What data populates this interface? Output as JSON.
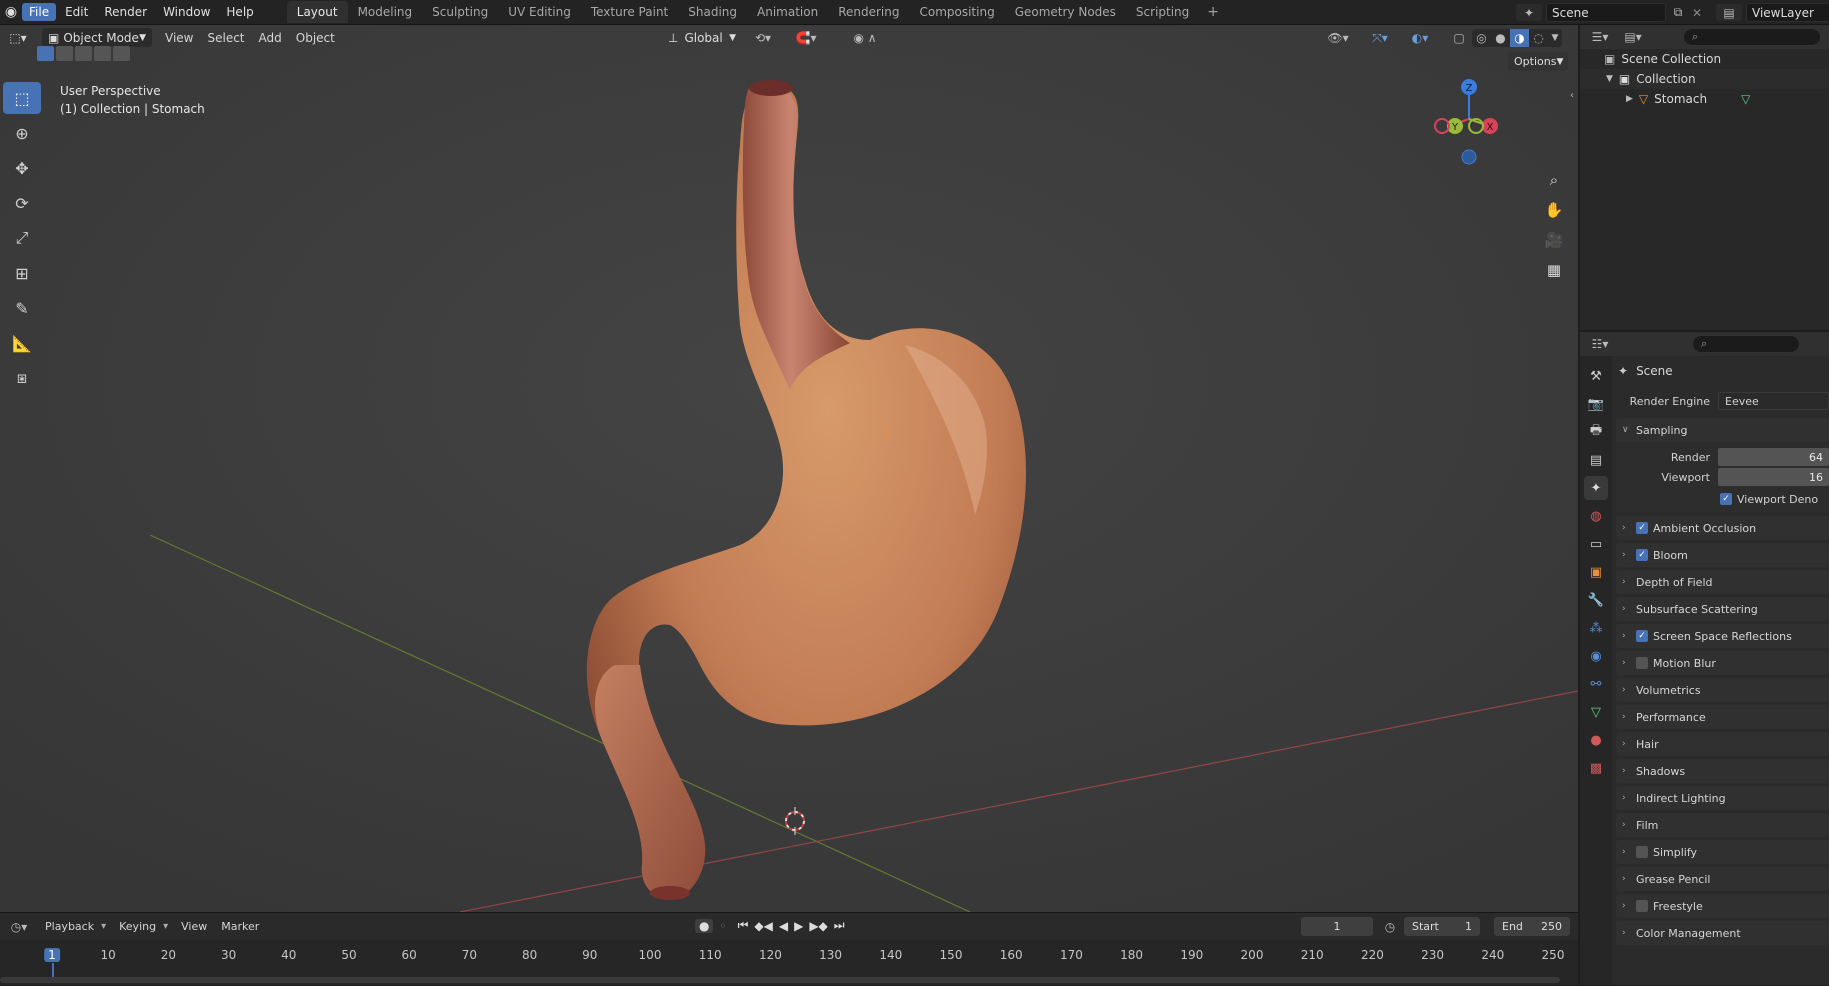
{
  "menu": {
    "items": [
      "File",
      "Edit",
      "Render",
      "Window",
      "Help"
    ],
    "active_index": 0
  },
  "workspaces": {
    "tabs": [
      "Layout",
      "Modeling",
      "Sculpting",
      "UV Editing",
      "Texture Paint",
      "Shading",
      "Animation",
      "Rendering",
      "Compositing",
      "Geometry Nodes",
      "Scripting"
    ],
    "active_index": 0,
    "add_label": "+"
  },
  "scene_selector": {
    "value": "Scene"
  },
  "view_layer_selector": {
    "value": "ViewLayer"
  },
  "viewport_header": {
    "mode": "Object Mode",
    "menus": [
      "View",
      "Select",
      "Add",
      "Object"
    ],
    "orientation": "Global",
    "options_label": "Options"
  },
  "viewport": {
    "perspective_label": "User Perspective",
    "context_label": "(1) Collection | Stomach",
    "gizmo": {
      "z": "Z",
      "y": "Y",
      "x": "X"
    },
    "x_axis_color": "#a84a4a",
    "y_axis_color": "#6b8a2e",
    "object_name": "Stomach"
  },
  "outliner": {
    "rows": [
      {
        "label": "Scene Collection"
      },
      {
        "label": "Collection"
      },
      {
        "label": "Stomach"
      }
    ]
  },
  "properties": {
    "context": "Scene",
    "render_engine_label": "Render Engine",
    "render_engine_value": "Eevee",
    "sampling_label": "Sampling",
    "render_label": "Render",
    "render_value": "64",
    "viewport_label": "Viewport",
    "viewport_value": "16",
    "viewport_denoise_label": "Viewport Deno",
    "panels": [
      {
        "label": "Ambient Occlusion",
        "checkbox": true,
        "checked": true
      },
      {
        "label": "Bloom",
        "checkbox": true,
        "checked": true
      },
      {
        "label": "Depth of Field",
        "checkbox": false
      },
      {
        "label": "Subsurface Scattering",
        "checkbox": false
      },
      {
        "label": "Screen Space Reflections",
        "checkbox": true,
        "checked": true
      },
      {
        "label": "Motion Blur",
        "checkbox": true,
        "checked": false
      },
      {
        "label": "Volumetrics",
        "checkbox": false
      },
      {
        "label": "Performance",
        "checkbox": false
      },
      {
        "label": "Hair",
        "checkbox": false
      },
      {
        "label": "Shadows",
        "checkbox": false
      },
      {
        "label": "Indirect Lighting",
        "checkbox": false
      },
      {
        "label": "Film",
        "checkbox": false
      },
      {
        "label": "Simplify",
        "checkbox": true,
        "checked": false
      },
      {
        "label": "Grease Pencil",
        "checkbox": false
      },
      {
        "label": "Freestyle",
        "checkbox": true,
        "checked": false
      },
      {
        "label": "Color Management",
        "checkbox": false
      }
    ]
  },
  "timeline": {
    "menus": [
      "Playback",
      "Keying",
      "View",
      "Marker"
    ],
    "current_frame": "1",
    "start_label": "Start",
    "start_value": "1",
    "end_label": "End",
    "end_value": "250",
    "ruler": [
      "1",
      "10",
      "20",
      "30",
      "40",
      "50",
      "60",
      "70",
      "80",
      "90",
      "100",
      "110",
      "120",
      "130",
      "140",
      "150",
      "160",
      "170",
      "180",
      "190",
      "200",
      "210",
      "220",
      "230",
      "240",
      "250"
    ]
  }
}
